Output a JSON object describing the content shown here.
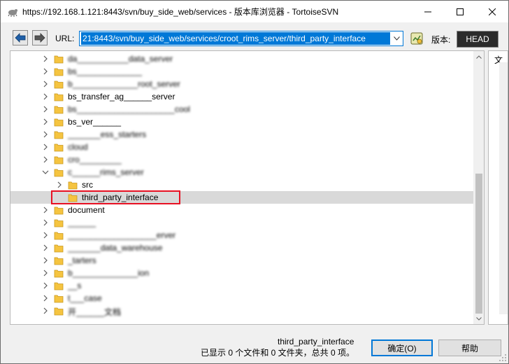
{
  "window": {
    "title": "https://192.168.1.121:8443/svn/buy_side_web/services - 版本库浏览器 - TortoiseSVN"
  },
  "toolbar": {
    "url_label": "URL:",
    "url_value": "21:8443/svn/buy_side_web/services/croot_rims_server/third_party_interface",
    "revision_label": "版本:",
    "revision_value": "HEAD"
  },
  "tree": {
    "rows": [
      {
        "label": "da___________data_server",
        "indent": 0,
        "expanded": false,
        "blurred": true,
        "selected": false
      },
      {
        "label": "bs______________",
        "indent": 0,
        "expanded": false,
        "blurred": true,
        "selected": false
      },
      {
        "label": "b______________root_server",
        "indent": 0,
        "expanded": false,
        "blurred": true,
        "selected": false
      },
      {
        "label": "bs_transfer_ag______server",
        "indent": 0,
        "expanded": false,
        "blurred": false,
        "selected": false
      },
      {
        "label": "bs_____________________cool",
        "indent": 0,
        "expanded": false,
        "blurred": true,
        "selected": false
      },
      {
        "label": "bs_ver______",
        "indent": 0,
        "expanded": false,
        "blurred": false,
        "selected": false
      },
      {
        "label": "_______ess_starters",
        "indent": 0,
        "expanded": false,
        "blurred": true,
        "selected": false
      },
      {
        "label": "cloud",
        "indent": 0,
        "expanded": false,
        "blurred": true,
        "selected": false
      },
      {
        "label": "cro_________",
        "indent": 0,
        "expanded": false,
        "blurred": true,
        "selected": false
      },
      {
        "label": "c______rims_server",
        "indent": 0,
        "expanded": true,
        "blurred": true,
        "selected": false
      },
      {
        "label": "src",
        "indent": 1,
        "expanded": false,
        "blurred": false,
        "selected": false
      },
      {
        "label": "third_party_interface",
        "indent": 1,
        "expanded": null,
        "blurred": false,
        "selected": true
      },
      {
        "label": "document",
        "indent": 0,
        "expanded": false,
        "blurred": false,
        "selected": false
      },
      {
        "label": "______",
        "indent": 0,
        "expanded": false,
        "blurred": true,
        "selected": false
      },
      {
        "label": "___________________erver",
        "indent": 0,
        "expanded": false,
        "blurred": true,
        "selected": false
      },
      {
        "label": "_______data_warehouse",
        "indent": 0,
        "expanded": false,
        "blurred": true,
        "selected": false
      },
      {
        "label": "_tarters",
        "indent": 0,
        "expanded": false,
        "blurred": true,
        "selected": false
      },
      {
        "label": "b______________ion",
        "indent": 0,
        "expanded": false,
        "blurred": true,
        "selected": false
      },
      {
        "label": "__s",
        "indent": 0,
        "expanded": false,
        "blurred": true,
        "selected": false
      },
      {
        "label": "t___case",
        "indent": 0,
        "expanded": false,
        "blurred": true,
        "selected": false
      },
      {
        "label": "开______文档",
        "indent": 0,
        "expanded": false,
        "blurred": true,
        "selected": false
      }
    ]
  },
  "right_pane": {
    "header": "文"
  },
  "status": {
    "path": "third_party_interface",
    "summary": "已显示 0 个文件和 0 文件夹，总共 0 项。"
  },
  "buttons": {
    "ok": "确定(O)",
    "help": "帮助"
  },
  "colors": {
    "accent": "#0078d7",
    "selection_box": "#e81123",
    "folder": "#f5c440"
  }
}
